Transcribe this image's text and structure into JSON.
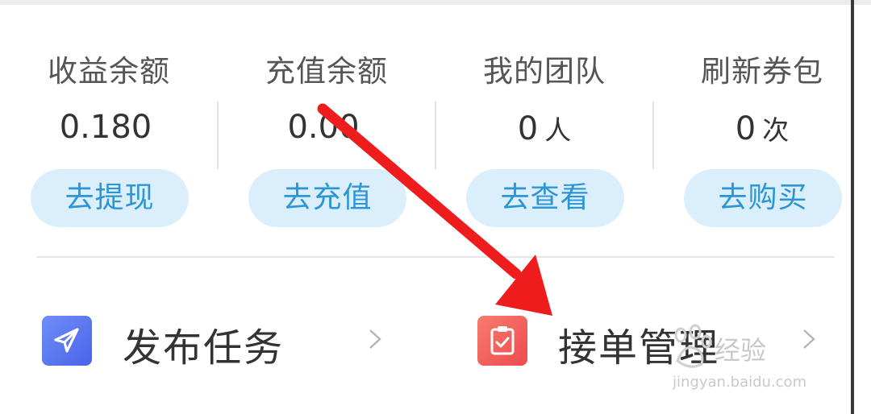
{
  "stats": [
    {
      "label": "收益余额",
      "value": "0.180",
      "unit": "",
      "button": "去提现"
    },
    {
      "label": "充值余额",
      "value": "0.00",
      "unit": "",
      "button": "去充值"
    },
    {
      "label": "我的团队",
      "value": "0",
      "unit": "人",
      "button": "去查看"
    },
    {
      "label": "刷新券包",
      "value": "0",
      "unit": "次",
      "button": "去购买"
    }
  ],
  "entries": [
    {
      "label": "发布任务",
      "icon": "paper-plane-icon",
      "color": "#5b7cf5"
    },
    {
      "label": "接单管理",
      "icon": "clipboard-check-icon",
      "color": "#f25a57"
    }
  ],
  "watermark": {
    "text": "经验",
    "url": "jingyan.baidu.com"
  },
  "colors": {
    "accent": "#2b95d6",
    "button_bg": "#dbeefb",
    "arrow": "#ee1c1c"
  }
}
